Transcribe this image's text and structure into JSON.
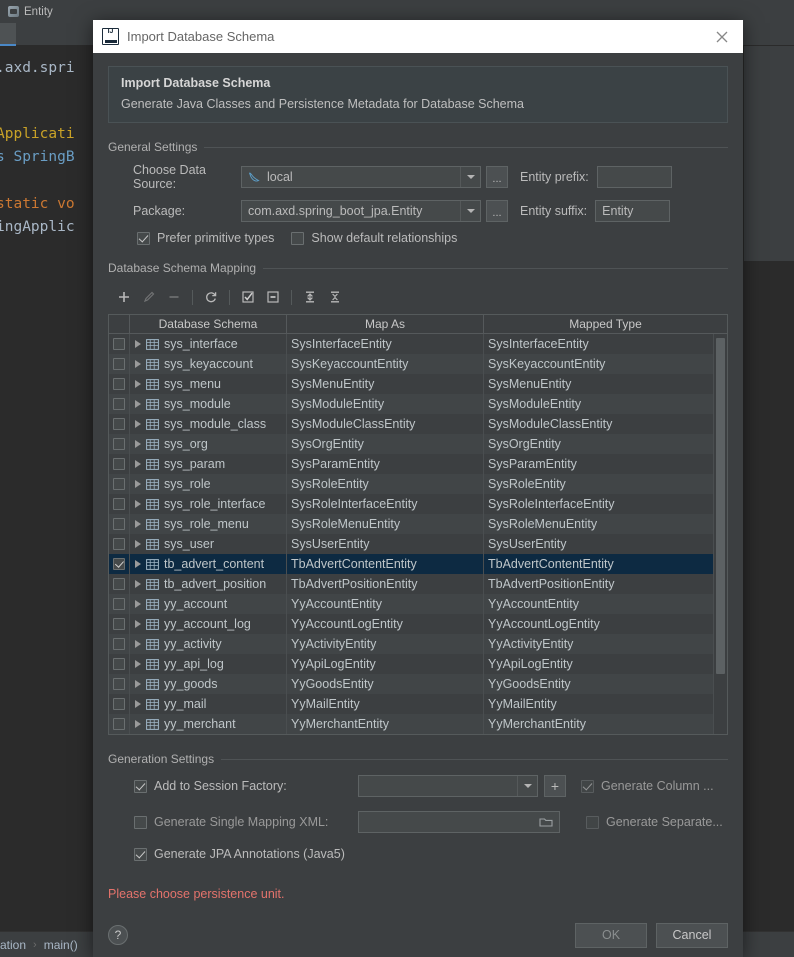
{
  "background": {
    "tab_label": "Entity",
    "code_lines": [
      ".axd.spri",
      "Applicati",
      "s SpringB",
      "static vo",
      "ingApplic"
    ],
    "breadcrumb": [
      "ation",
      "main()"
    ]
  },
  "dialog": {
    "window_title": "Import Database Schema",
    "banner": {
      "title": "Import Database Schema",
      "subtitle": "Generate Java Classes and Persistence Metadata for Database Schema"
    },
    "general_settings": {
      "legend": "General Settings",
      "data_source_label": "Choose Data Source:",
      "data_source_value": "local",
      "data_source_browse": "...",
      "entity_prefix_label": "Entity prefix:",
      "entity_prefix_value": "",
      "package_label": "Package:",
      "package_value": "com.axd.spring_boot_jpa.Entity",
      "package_browse": "...",
      "entity_suffix_label": "Entity suffix:",
      "entity_suffix_value": "Entity",
      "prefer_primitive_label": "Prefer primitive types",
      "prefer_primitive_checked": true,
      "show_default_rel_label": "Show default relationships",
      "show_default_rel_checked": false
    },
    "schema_mapping": {
      "legend": "Database Schema Mapping",
      "toolbar": [
        {
          "name": "add",
          "glyph": "+",
          "enabled": true
        },
        {
          "name": "edit",
          "glyph": "pencil",
          "enabled": false
        },
        {
          "name": "remove",
          "glyph": "minus",
          "enabled": false
        },
        {
          "name": "refresh",
          "glyph": "refresh",
          "enabled": true
        },
        {
          "name": "select-all",
          "glyph": "checked-box",
          "enabled": true
        },
        {
          "name": "deselect-all",
          "glyph": "unchecked-box",
          "enabled": true
        },
        {
          "name": "expand-all",
          "glyph": "expand",
          "enabled": true
        },
        {
          "name": "collapse-all",
          "glyph": "collapse",
          "enabled": true
        }
      ],
      "columns": [
        "Database Schema",
        "Map As",
        "Mapped Type"
      ],
      "rows": [
        {
          "checked": false,
          "schema": "sys_interface",
          "map_as": "SysInterfaceEntity",
          "mapped_type": "SysInterfaceEntity",
          "selected": false
        },
        {
          "checked": false,
          "schema": "sys_keyaccount",
          "map_as": "SysKeyaccountEntity",
          "mapped_type": "SysKeyaccountEntity",
          "selected": false
        },
        {
          "checked": false,
          "schema": "sys_menu",
          "map_as": "SysMenuEntity",
          "mapped_type": "SysMenuEntity",
          "selected": false
        },
        {
          "checked": false,
          "schema": "sys_module",
          "map_as": "SysModuleEntity",
          "mapped_type": "SysModuleEntity",
          "selected": false
        },
        {
          "checked": false,
          "schema": "sys_module_class",
          "map_as": "SysModuleClassEntity",
          "mapped_type": "SysModuleClassEntity",
          "selected": false
        },
        {
          "checked": false,
          "schema": "sys_org",
          "map_as": "SysOrgEntity",
          "mapped_type": "SysOrgEntity",
          "selected": false
        },
        {
          "checked": false,
          "schema": "sys_param",
          "map_as": "SysParamEntity",
          "mapped_type": "SysParamEntity",
          "selected": false
        },
        {
          "checked": false,
          "schema": "sys_role",
          "map_as": "SysRoleEntity",
          "mapped_type": "SysRoleEntity",
          "selected": false
        },
        {
          "checked": false,
          "schema": "sys_role_interface",
          "map_as": "SysRoleInterfaceEntity",
          "mapped_type": "SysRoleInterfaceEntity",
          "selected": false
        },
        {
          "checked": false,
          "schema": "sys_role_menu",
          "map_as": "SysRoleMenuEntity",
          "mapped_type": "SysRoleMenuEntity",
          "selected": false
        },
        {
          "checked": false,
          "schema": "sys_user",
          "map_as": "SysUserEntity",
          "mapped_type": "SysUserEntity",
          "selected": false
        },
        {
          "checked": true,
          "schema": "tb_advert_content",
          "map_as": "TbAdvertContentEntity",
          "mapped_type": "TbAdvertContentEntity",
          "selected": true
        },
        {
          "checked": false,
          "schema": "tb_advert_position",
          "map_as": "TbAdvertPositionEntity",
          "mapped_type": "TbAdvertPositionEntity",
          "selected": false
        },
        {
          "checked": false,
          "schema": "yy_account",
          "map_as": "YyAccountEntity",
          "mapped_type": "YyAccountEntity",
          "selected": false
        },
        {
          "checked": false,
          "schema": "yy_account_log",
          "map_as": "YyAccountLogEntity",
          "mapped_type": "YyAccountLogEntity",
          "selected": false
        },
        {
          "checked": false,
          "schema": "yy_activity",
          "map_as": "YyActivityEntity",
          "mapped_type": "YyActivityEntity",
          "selected": false
        },
        {
          "checked": false,
          "schema": "yy_api_log",
          "map_as": "YyApiLogEntity",
          "mapped_type": "YyApiLogEntity",
          "selected": false
        },
        {
          "checked": false,
          "schema": "yy_goods",
          "map_as": "YyGoodsEntity",
          "mapped_type": "YyGoodsEntity",
          "selected": false
        },
        {
          "checked": false,
          "schema": "yy_mail",
          "map_as": "YyMailEntity",
          "mapped_type": "YyMailEntity",
          "selected": false
        },
        {
          "checked": false,
          "schema": "yy_merchant",
          "map_as": "YyMerchantEntity",
          "mapped_type": "YyMerchantEntity",
          "selected": false
        }
      ]
    },
    "generation_settings": {
      "legend": "Generation Settings",
      "add_session_factory_label": "Add to Session Factory:",
      "add_session_factory_checked": true,
      "session_factory_value": "",
      "add_session_factory_plus": "+",
      "generate_column_label": "Generate Column ...",
      "generate_column_checked": true,
      "single_mapping_xml_label": "Generate Single Mapping XML:",
      "single_mapping_xml_checked": false,
      "single_mapping_xml_value": "",
      "generate_separate_label": "Generate Separate...",
      "generate_separate_checked": false,
      "jpa_annotations_label": "Generate JPA Annotations (Java5)",
      "jpa_annotations_checked": true
    },
    "error_message": "Please choose persistence unit.",
    "footer": {
      "help_label": "?",
      "ok_label": "OK",
      "ok_enabled": false,
      "cancel_label": "Cancel"
    }
  },
  "colors": {
    "dialog_bg": "#3c3f41",
    "selection": "#0d2a42",
    "error": "#e4736c",
    "accent": "#4a88c7"
  }
}
